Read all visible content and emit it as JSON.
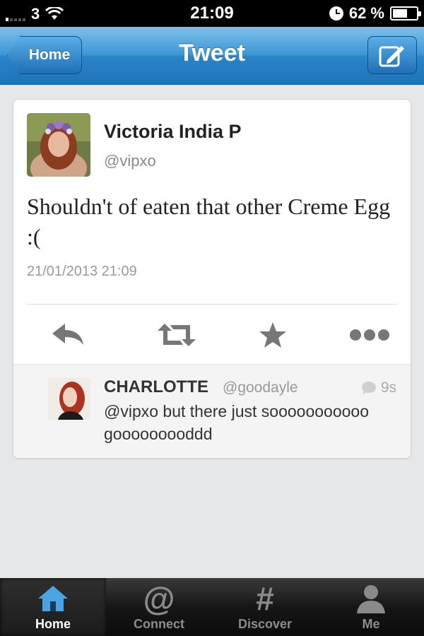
{
  "status_bar": {
    "carrier": "3",
    "time": "21:09",
    "battery_percent": "62 %",
    "battery_level": 0.62
  },
  "nav": {
    "back_label": "Home",
    "title": "Tweet"
  },
  "tweet": {
    "author_name": "Victoria India P",
    "author_handle": "@vipxo",
    "text": "Shouldn't of eaten that other Creme Egg :(",
    "timestamp": "21/01/2013 21:09",
    "actions": [
      "reply-icon",
      "retweet-icon",
      "favorite-star-icon",
      "more-icon"
    ]
  },
  "reply": {
    "author_name": "CHARLOTTE",
    "author_handle": "@goodayle",
    "age": "9s",
    "text": "@vipxo but there just sooooooooooo gooooooooddd"
  },
  "tabbar": {
    "tabs": [
      {
        "label": "Home",
        "icon": "house-icon",
        "active": true
      },
      {
        "label": "Connect",
        "icon": "at-icon",
        "active": false
      },
      {
        "label": "Discover",
        "icon": "hash-icon",
        "active": false
      },
      {
        "label": "Me",
        "icon": "person-icon",
        "active": false
      }
    ]
  },
  "colors": {
    "nav_blue": "#2b84c8",
    "tab_active_blue": "#4ba3e3",
    "background": "#e6e7e9"
  }
}
